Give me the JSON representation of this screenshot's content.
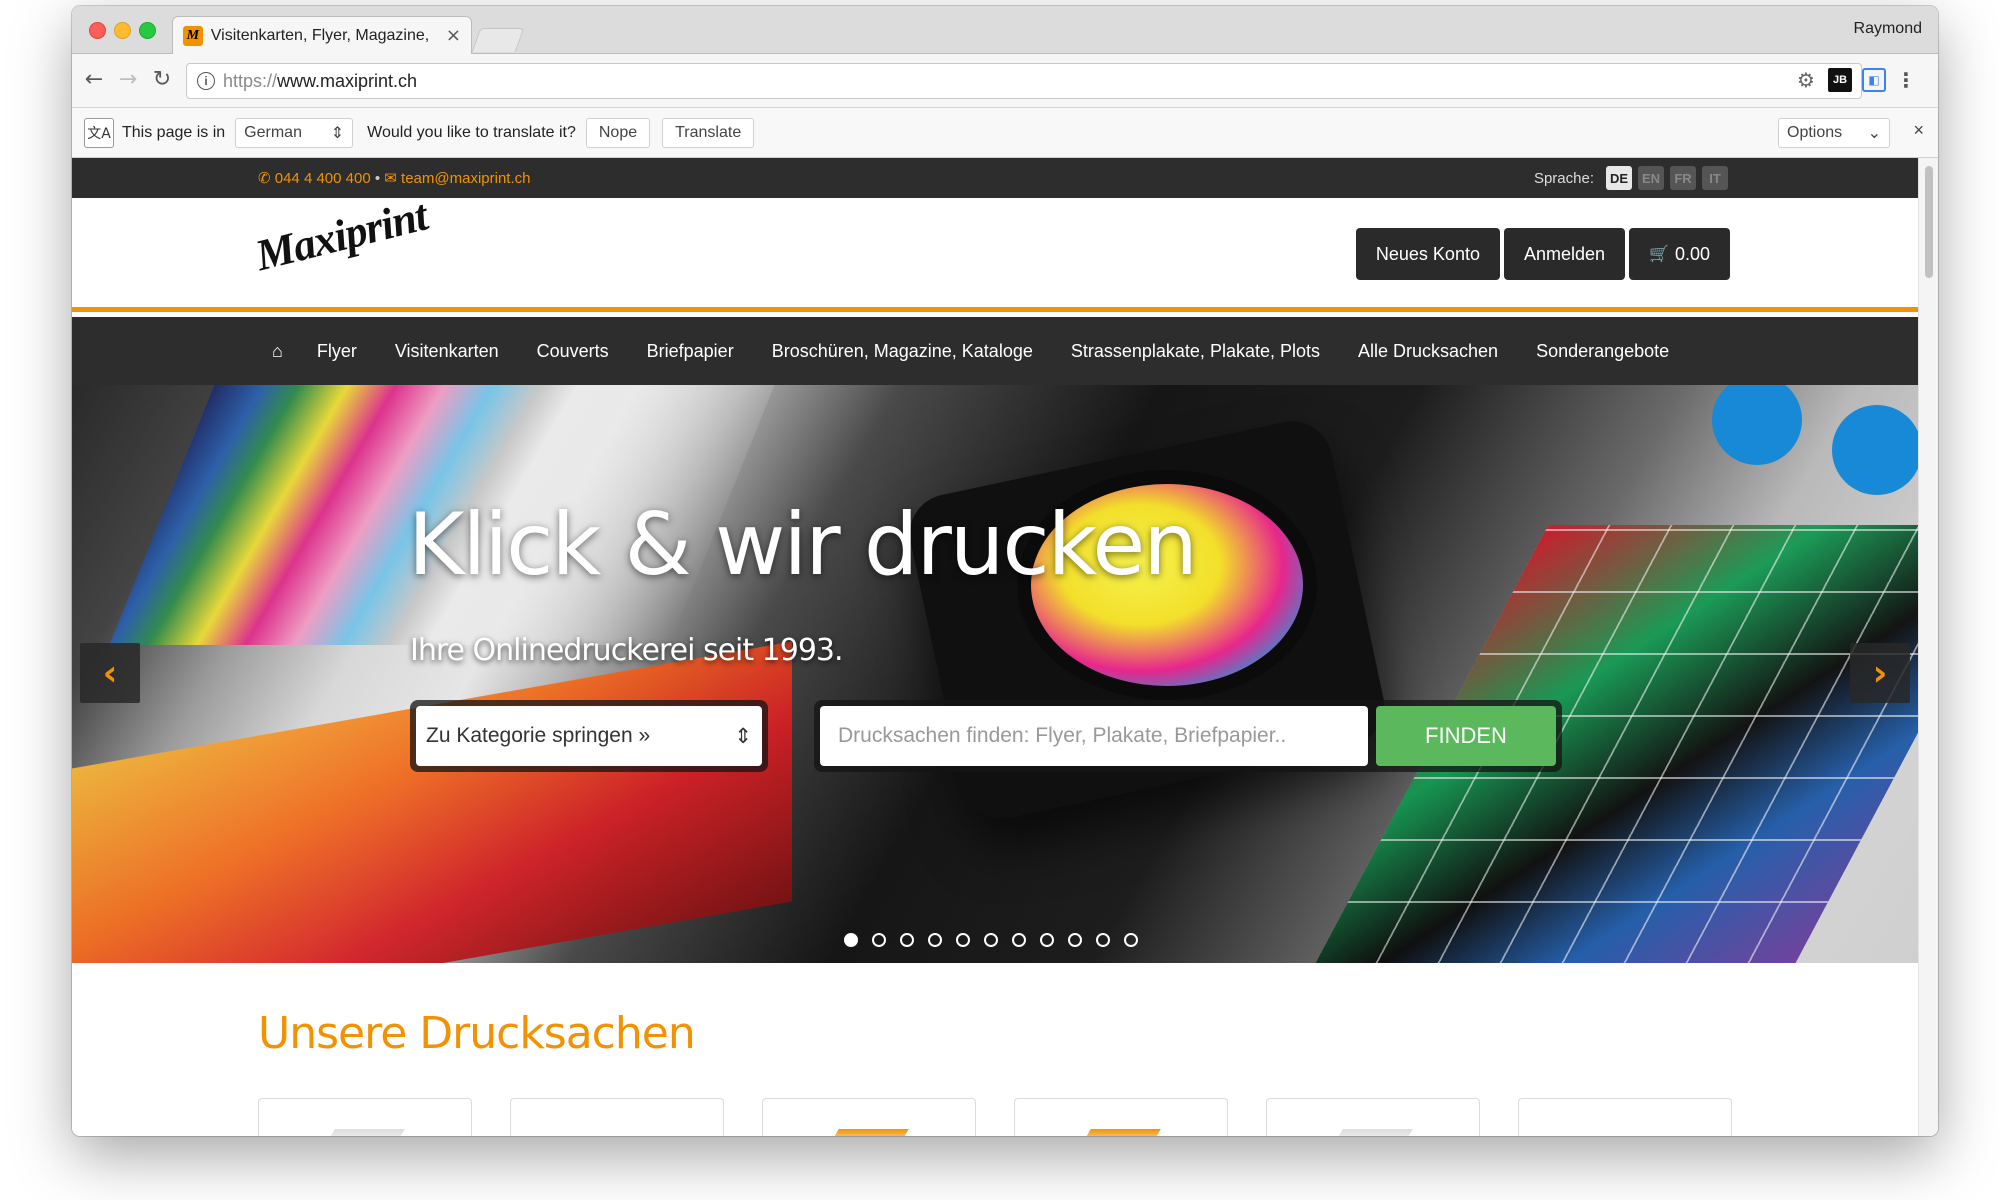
{
  "browser": {
    "tab_title": "Visitenkarten, Flyer, Magazine,",
    "profile_name": "Raymond",
    "url_scheme": "https://",
    "url_host": "www.maxiprint.ch",
    "favicon_letter": "M"
  },
  "translate_bar": {
    "prefix": "This page is in",
    "language": "German",
    "question": "Would you like to translate it?",
    "nope_label": "Nope",
    "translate_label": "Translate",
    "options_label": "Options"
  },
  "site": {
    "phone": "044 4 400 400",
    "email": "team@maxiprint.ch",
    "language_label": "Sprache:",
    "languages": [
      {
        "code": "DE",
        "active": true
      },
      {
        "code": "EN",
        "active": false
      },
      {
        "code": "FR",
        "active": false
      },
      {
        "code": "IT",
        "active": false
      }
    ],
    "logo_text": "Maxiprint",
    "header_buttons": {
      "new_account": "Neues Konto",
      "login": "Anmelden",
      "cart_total": "0.00"
    },
    "nav": [
      "Flyer",
      "Visitenkarten",
      "Couverts",
      "Briefpapier",
      "Broschüren, Magazine, Kataloge",
      "Strassenplakate, Plakate, Plots",
      "Alle Drucksachen",
      "Sonderangebote"
    ],
    "hero": {
      "title": "Klick & wir drucken",
      "subtitle": "Ihre Onlinedruckerei seit 1993.",
      "category_select": "Zu Kategorie springen »",
      "search_placeholder": "Drucksachen finden: Flyer, Plakate, Briefpapier..",
      "find_label": "FINDEN",
      "slide_count": 11,
      "active_slide": 1
    },
    "products": {
      "section_title": "Unsere Drucksachen"
    }
  },
  "colors": {
    "accent": "#f39200",
    "dark": "#2d2d2d",
    "find_button": "#5cb85c"
  }
}
